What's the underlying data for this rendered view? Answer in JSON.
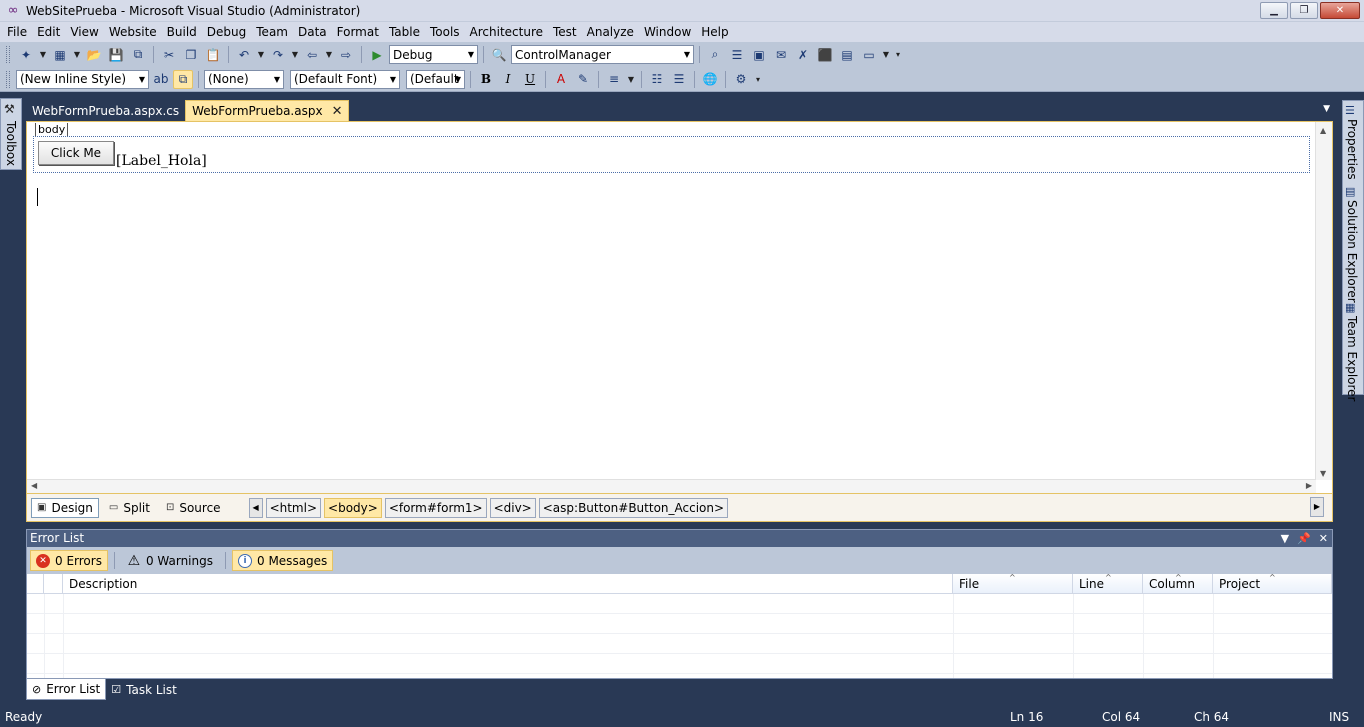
{
  "window": {
    "title": "WebSitePrueba - Microsoft Visual Studio (Administrator)",
    "controls": {
      "minimize": "▁",
      "restore": "❐",
      "close": "✕"
    }
  },
  "menu": [
    "File",
    "Edit",
    "View",
    "Website",
    "Build",
    "Debug",
    "Team",
    "Data",
    "Format",
    "Table",
    "Tools",
    "Architecture",
    "Test",
    "Analyze",
    "Window",
    "Help"
  ],
  "toolbar1": {
    "configuration": "Debug",
    "find_combo": "ControlManager"
  },
  "toolbar2": {
    "style_combo": "(New Inline Style)",
    "block_format_combo": "(None)",
    "font_combo": "(Default Font)",
    "size_combo": "(Default",
    "bold_label": "B",
    "italic_label": "I",
    "underline_label": "U"
  },
  "left_strip": {
    "toolbox": "Toolbox"
  },
  "right_strip": {
    "properties": "Properties",
    "solution_explorer": "Solution Explorer",
    "team_explorer": "Team Explorer"
  },
  "tabs": [
    {
      "label": "WebFormPrueba.aspx.cs"
    },
    {
      "label": "WebFormPrueba.aspx",
      "close": "✕"
    }
  ],
  "editor": {
    "tag_indicator": "body",
    "button_text": "Click Me",
    "label_text": "[Label_Hola]"
  },
  "view_bar": {
    "design": "Design",
    "split": "Split",
    "source": "Source",
    "breadcrumbs": [
      "<html>",
      "<body>",
      "<form#form1>",
      "<div>",
      "<asp:Button#Button_Accion>"
    ]
  },
  "error_list": {
    "title": "Error List",
    "errors": "0 Errors",
    "warnings": "0 Warnings",
    "messages": "0 Messages",
    "columns": [
      "Description",
      "File",
      "Line",
      "Column",
      "Project"
    ]
  },
  "panel_tabs": [
    "Error List",
    "Task List"
  ],
  "status": {
    "state": "Ready",
    "ln": "Ln 16",
    "col": "Col 64",
    "ch": "Ch 64",
    "mode": "INS"
  }
}
